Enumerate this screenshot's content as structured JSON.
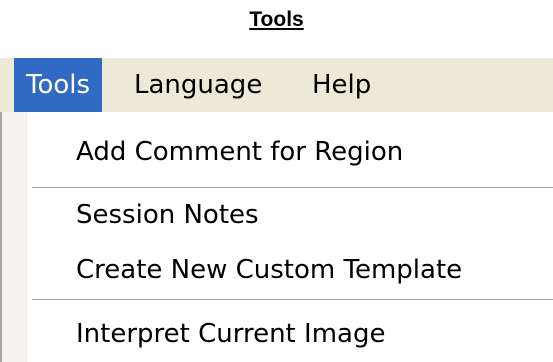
{
  "caption": "Tools",
  "menubar": {
    "items": [
      {
        "label": "Tools"
      },
      {
        "label": "Language"
      },
      {
        "label": "Help"
      }
    ]
  },
  "tools_menu": {
    "items": [
      {
        "label": "Add Comment for Region"
      },
      {
        "label": "Session Notes"
      },
      {
        "label": "Create New Custom Template"
      },
      {
        "label": "Interpret Current Image"
      }
    ]
  },
  "colors": {
    "menubar_bg": "#ece9d8",
    "highlight": "#316ac5",
    "highlight_text": "#ffffff",
    "separator": "#aca899"
  }
}
